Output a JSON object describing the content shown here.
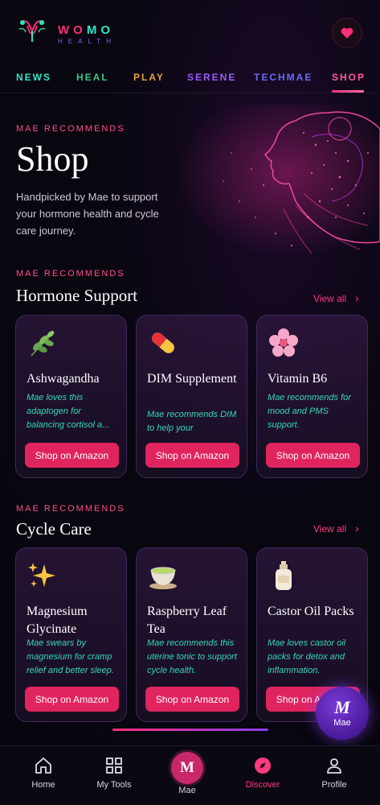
{
  "brand": {
    "name_part1": "WO",
    "name_part2": "MO",
    "sub": "HEALTH",
    "logo_icon": "uterus-logo-icon",
    "favorite_icon": "heart-icon"
  },
  "tabs": [
    {
      "label": "NEWS",
      "color": "#2ee6c8"
    },
    {
      "label": "HEAL",
      "color": "#36c98a"
    },
    {
      "label": "PLAY",
      "color": "#e6a23c"
    },
    {
      "label": "SERENE",
      "color": "#9b59ff"
    },
    {
      "label": "TECHMAE",
      "color": "#6a6cf0"
    },
    {
      "label": "SHOP",
      "color": "#ff5a9a",
      "active": true
    }
  ],
  "hero": {
    "kicker": "MAE RECOMMENDS",
    "title": "Shop",
    "subtitle": "Handpicked by Mae to support your hormone health and cycle care journey."
  },
  "sections": [
    {
      "kicker": "MAE RECOMMENDS",
      "title": "Hormone Support",
      "view_all": "View all",
      "cards": [
        {
          "icon": "herb-icon",
          "name": "Ashwagandha",
          "desc": "Mae loves this adaptogen for balancing cortisol a...",
          "button": "Shop on Amazon"
        },
        {
          "icon": "pill-icon",
          "name": "DIM Supplement",
          "desc": "Mae recommends DIM to help your",
          "button": "Shop on Amazon"
        },
        {
          "icon": "blossom-icon",
          "name": "Vitamin B6",
          "desc": "Mae recommends for mood and PMS support.",
          "button": "Shop on Amazon"
        }
      ]
    },
    {
      "kicker": "MAE RECOMMENDS",
      "title": "Cycle Care",
      "view_all": "View all",
      "cards": [
        {
          "icon": "sparkles-icon",
          "name": "Magnesium Glycinate",
          "desc": "Mae swears by magnesium for cramp relief and better sleep.",
          "button": "Shop on Amazon"
        },
        {
          "icon": "tea-icon",
          "name": "Raspberry Leaf Tea",
          "desc": "Mae recommends this uterine tonic to support cycle health.",
          "button": "Shop on Amazon"
        },
        {
          "icon": "lotion-bottle-icon",
          "name": "Castor Oil Packs",
          "desc": "Mae loves castor oil packs for detox and inflammation.",
          "button": "Shop on Amazon"
        }
      ]
    }
  ],
  "fab": {
    "letter": "M",
    "label": "Mae"
  },
  "bottom_nav": [
    {
      "icon": "home-icon",
      "label": "Home"
    },
    {
      "icon": "grid-icon",
      "label": "My Tools"
    },
    {
      "icon": "mae-avatar-icon",
      "label": "Mae",
      "letter": "M"
    },
    {
      "icon": "compass-icon",
      "label": "Discover",
      "active": true,
      "color": "#ff3a7e"
    },
    {
      "icon": "person-icon",
      "label": "Profile"
    }
  ]
}
